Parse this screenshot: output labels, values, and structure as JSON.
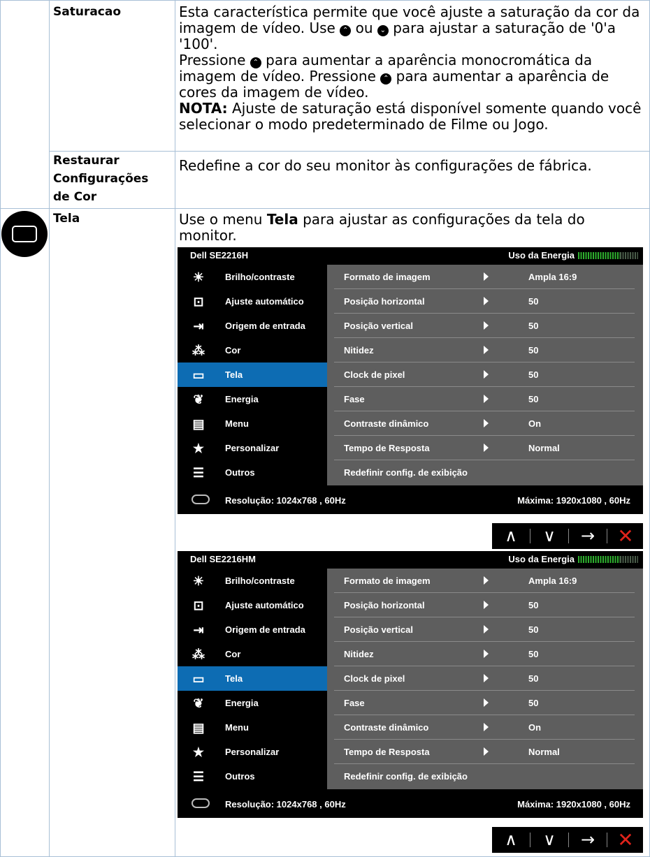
{
  "rows": {
    "saturacao": {
      "label": "Saturacao",
      "p1_a": "Esta característica permite que você ajuste a saturação da cor da imagem de vídeo. Use ",
      "p1_or": " ou ",
      "p1_b": " para ajustar a saturação de '0'a '100'.",
      "p2_a": "Pressione ",
      "p2_b": " para aumentar a aparência monocromática da imagem de vídeo. Pressione ",
      "p2_c": " para aumentar a aparência de cores da imagem de vídeo.",
      "note_label": "NOTA:",
      "note_text": " Ajuste de saturação está disponível somente quando você selecionar o modo predeterminado de Filme ou Jogo."
    },
    "restaurar": {
      "label_1": "Restaurar",
      "label_2": "Configurações",
      "label_3": "de Cor",
      "text": "Redefine a cor do seu monitor às configurações de fábrica."
    },
    "tela": {
      "label": "Tela",
      "text_a": "Use o menu ",
      "text_bold": "Tela",
      "text_b": " para ajustar as configurações da tela do monitor."
    }
  },
  "icons": {
    "up_glyph": "⌃",
    "down_glyph": "⌄"
  },
  "osd1": {
    "model": "Dell SE2216H",
    "energy_label": "Uso da Energia",
    "menu": [
      "Brilho/contraste",
      "Ajuste automático",
      "Origem de entrada",
      "Cor",
      "Tela",
      "Energia",
      "Menu",
      "Personalizar",
      "Outros"
    ],
    "selected": "Tela",
    "settings": [
      {
        "name": "Formato de imagem",
        "value": "Ampla 16:9"
      },
      {
        "name": "Posição horizontal",
        "value": "50"
      },
      {
        "name": "Posição vertical",
        "value": "50"
      },
      {
        "name": "Nitidez",
        "value": "50"
      },
      {
        "name": "Clock de pixel",
        "value": "50"
      },
      {
        "name": "Fase",
        "value": "50"
      },
      {
        "name": "Contraste dinâmico",
        "value": "On"
      },
      {
        "name": "Tempo de Resposta",
        "value": "Normal"
      },
      {
        "name": "Redefinir config. de exibição",
        "value": ""
      }
    ],
    "resolution": "Resolução: 1024x768 , 60Hz",
    "max": "Máxima: 1920x1080 , 60Hz"
  },
  "osd2": {
    "model": "Dell  SE2216HM",
    "energy_label": "Uso da Energia",
    "menu": [
      "Brilho/contraste",
      "Ajuste automático",
      "Origem de entrada",
      "Cor",
      "Tela",
      "Energia",
      "Menu",
      "Personalizar",
      "Outros"
    ],
    "selected": "Tela",
    "settings": [
      {
        "name": "Formato de imagem",
        "value": "Ampla 16:9"
      },
      {
        "name": "Posição horizontal",
        "value": "50"
      },
      {
        "name": "Posição vertical",
        "value": "50"
      },
      {
        "name": "Nitidez",
        "value": "50"
      },
      {
        "name": "Clock de pixel",
        "value": "50"
      },
      {
        "name": "Fase",
        "value": "50"
      },
      {
        "name": "Contraste dinâmico",
        "value": "On"
      },
      {
        "name": "Tempo de Resposta",
        "value": "Normal"
      },
      {
        "name": "Redefinir config. de exibição",
        "value": ""
      }
    ],
    "resolution": "Resolução: 1024x768 , 60Hz",
    "max": "Máxima: 1920x1080 , 60Hz"
  },
  "buttons": {
    "up": "∧",
    "down": "∨",
    "enter": "→",
    "exit": "✕"
  },
  "colors": {
    "table_lines": "#a8c0d6",
    "osd_selected": "#0d6cb3",
    "osd_panel": "#5e5e5e",
    "energy_bar": "#2eb02e",
    "exit_button": "#e0231b"
  }
}
